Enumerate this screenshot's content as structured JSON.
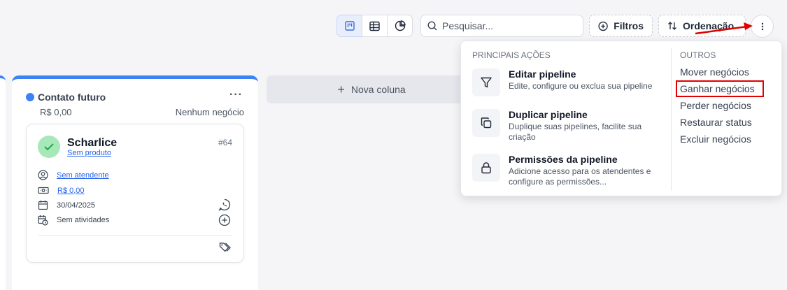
{
  "toolbar": {
    "views": [
      {
        "name": "kanban-view",
        "icon": "kanban-icon",
        "active": true
      },
      {
        "name": "table-view",
        "icon": "table-icon",
        "active": false
      },
      {
        "name": "chart-view",
        "icon": "pie-chart-icon",
        "active": false
      }
    ],
    "search_placeholder": "Pesquisar...",
    "filters_label": "Filtros",
    "sort_label": "Ordenação",
    "more_icon": "vertical-dots-icon"
  },
  "column": {
    "title": "Contato futuro",
    "value": "R$ 0,00",
    "count_text": "Nenhum negócio",
    "accent_color": "#3b82f6",
    "card": {
      "name": "Scharlice",
      "product": "Sem produto",
      "id": "#64",
      "attendant": "Sem atendente",
      "value": "R$ 0,00",
      "date": "30/04/2025",
      "activities": "Sem atividades"
    }
  },
  "new_column_label": "Nova coluna",
  "menu": {
    "main_title": "PRINCIPAIS AÇÕES",
    "main_items": [
      {
        "title": "Editar pipeline",
        "desc": "Edite, configure ou exclua sua pipeline",
        "icon": "filter-icon"
      },
      {
        "title": "Duplicar pipeline",
        "desc": "Duplique suas pipelines, facilite sua criação",
        "icon": "copy-icon"
      },
      {
        "title": "Permissões da pipeline",
        "desc": "Adicione acesso para os atendentes e configure as permissões...",
        "icon": "lock-icon"
      }
    ],
    "other_title": "OUTROS",
    "other_items": [
      "Mover negócios",
      "Ganhar negócios",
      "Perder negócios",
      "Restaurar status",
      "Excluir negócios"
    ],
    "highlighted_item": "Ganhar negócios",
    "highlight_color": "#e00000"
  }
}
